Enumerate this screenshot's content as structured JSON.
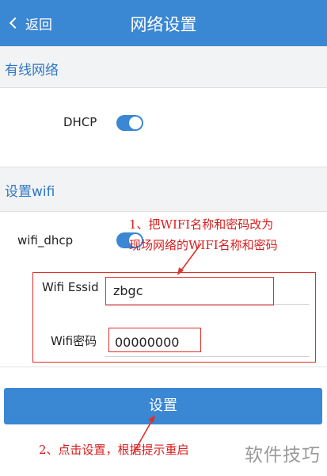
{
  "header": {
    "back_label": "返回",
    "title": "网络设置"
  },
  "wired": {
    "section_title": "有线网络",
    "dhcp_label": "DHCP",
    "dhcp_enabled": true
  },
  "wifi": {
    "section_title": "设置wifi",
    "dhcp_label": "wifi_dhcp",
    "dhcp_enabled": true,
    "essid_label": "Wifi Essid",
    "essid_value": "zbgc",
    "password_label": "Wifi密码",
    "password_value": "00000000"
  },
  "settings_button_label": "设置",
  "annotations": {
    "note1_line1": "1、把WIFI名称和密码改为",
    "note1_line2": "现场网络的WIFI名称和密码",
    "note2": "2、点击设置，根据提示重启"
  },
  "watermark": "软件技巧",
  "colors": {
    "primary": "#3a87d4",
    "annotation": "#e0302c",
    "section_bg": "#f2f3f5"
  }
}
